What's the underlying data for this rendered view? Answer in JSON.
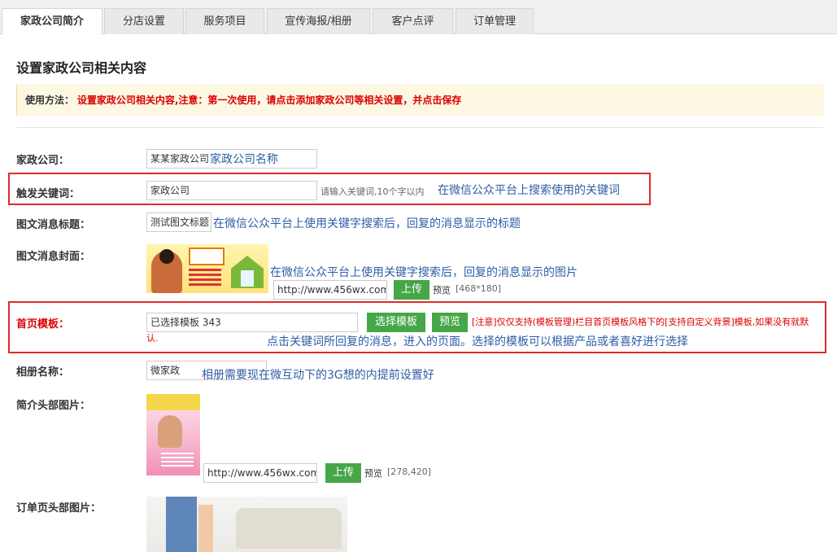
{
  "tabs": [
    {
      "label": "家政公司简介",
      "active": true
    },
    {
      "label": "分店设置",
      "active": false
    },
    {
      "label": "服务项目",
      "active": false
    },
    {
      "label": "宣传海报/相册",
      "active": false
    },
    {
      "label": "客户点评",
      "active": false
    },
    {
      "label": "订单管理",
      "active": false
    }
  ],
  "page_title": "设置家政公司相关内容",
  "notice": {
    "label": "使用方法：",
    "text": "设置家政公司相关内容,注意：第一次使用，请点击添加家政公司等相关设置，并点击保存"
  },
  "fields": {
    "company": {
      "label": "家政公司：",
      "value": "某某家政公司",
      "annotation": "家政公司名称"
    },
    "keyword": {
      "label": "触发关键词：",
      "value": "家政公司",
      "hint": "请输入关键词,10个字以内",
      "annotation": "在微信公众平台上搜索使用的关键词"
    },
    "msg_title": {
      "label": "图文消息标题：",
      "value": "测试图文标题",
      "annotation": "在微信公众平台上使用关键字搜索后，回复的消息显示的标题"
    },
    "msg_cover": {
      "label": "图文消息封面：",
      "url": "http://www.456wx.com/",
      "upload": "上传",
      "preview": "预览",
      "size": "[468*180]",
      "annotation": "在微信公众平台上使用关键字搜索后，回复的消息显示的图片"
    },
    "template": {
      "label": "首页模板：",
      "value": "已选择模板 343",
      "select_btn": "选择模板",
      "preview_btn": "预览",
      "warning": "[注意]仅仅支持(模板管理)栏目首页模板风格下的[支持自定义背景]模板,如果没有就默认.",
      "annotation": "点击关键词所回复的消息，进入的页面。选择的模板可以根据产品或者喜好进行选择"
    },
    "album": {
      "label": "相册名称：",
      "value": "微家政",
      "annotation": "相册需要现在微互动下的3G想的内提前设置好"
    },
    "intro_head": {
      "label": "简介头部图片：",
      "url": "http://www.456wx.com/",
      "upload": "上传",
      "preview": "预览",
      "size": "[278,420]"
    },
    "order_head": {
      "label": "订单页头部图片："
    }
  },
  "colors": {
    "accent_green": "#45a747",
    "warning_red": "#dd0000",
    "annotation_blue": "#2d5da6",
    "notice_bg": "#fcf8e3"
  }
}
